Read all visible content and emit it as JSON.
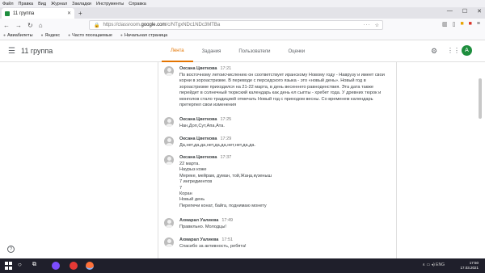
{
  "menubar": [
    "Файл",
    "Правка",
    "Вид",
    "Журнал",
    "Закладки",
    "Инструменты",
    "Справка"
  ],
  "browser": {
    "tab_title": "11 группа",
    "url_prefix": "https://classroom.",
    "url_domain": "google.com",
    "url_rest": "/c/NTgxNDc1NDc3MTBa",
    "bookmarks": [
      "Авиабилеты",
      "Яндекс",
      "Часто посещаемые",
      "Начальная страница"
    ]
  },
  "app": {
    "class_title": "11 группа",
    "tabs": [
      "Лента",
      "Задания",
      "Пользователи",
      "Оценки"
    ],
    "avatar_letter": "А"
  },
  "comments": [
    {
      "author": "Оксана Цветкова",
      "time": "17:21",
      "text": "По восточному летоисчислению он соответствует иранскому Новому году - Наврузу и имеет свои\nкорни в зороастризме. В переводе с персидского языка - это «новый день». Новый год в\nзороастризме приходился на 21-22 марта, в день весеннего равноденствия. Эта дата также\nперейдет в солнечный тюркский календарь как день ел сыпты - хребет года. У древних тюрок и\nмонголов стало традицией отмечать Новый год с приходом весны. Со временем календарь\nпретерпел свои изменения"
    },
    {
      "author": "Оксана Цветкова",
      "time": "17:25",
      "text": "Нан,Доп,Сут,Апа,Ата."
    },
    {
      "author": "Оксана Цветкова",
      "time": "17:29",
      "text": "Да,нет,да,да,нет,да,да,нет,нет,да,да."
    },
    {
      "author": "Оксана Цветкова",
      "time": "17:37",
      "text": "22 марта.\nНаурыз коже\nМереке, мейрам, думан, той,Жаңа,күзеныш\n7 ингредиентов\n7\nКоран\nНовый день\nПерепечи конат, байга, поднимаю монету"
    },
    {
      "author": "Ахмарал Уалиева",
      "time": "17:49",
      "text": "Правильно. Молодцы!"
    },
    {
      "author": "Ахмарал Уалиева",
      "time": "17:51",
      "text": "Спасибо за активность, ребята!"
    }
  ],
  "taskbar": {
    "lang": "ENG",
    "clock_time": "17:50",
    "clock_date": "17.03.2021"
  },
  "colors": {
    "active_tab": "#e37400",
    "avatar_green": "#1e8e3e",
    "taskbar": "#1f1f2b"
  }
}
